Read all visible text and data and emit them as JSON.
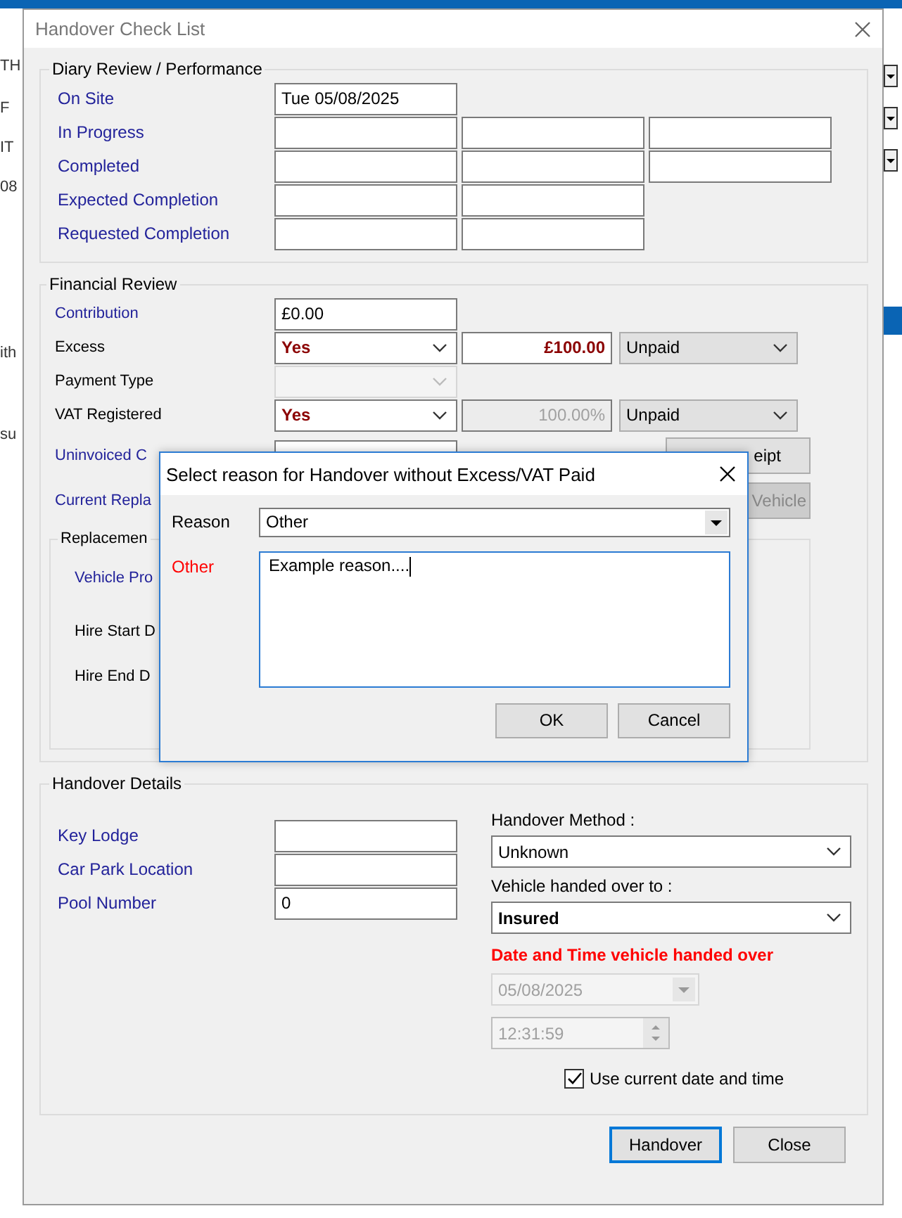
{
  "background": {
    "fragments": [
      "TH",
      "F",
      "IT",
      "08",
      "ith",
      "su"
    ]
  },
  "window": {
    "title": "Handover Check List"
  },
  "diary_review": {
    "title": "Diary Review / Performance",
    "rows": [
      {
        "label": "On Site",
        "fields": [
          {
            "kind": "text",
            "value": "Tue 05/08/2025"
          }
        ]
      },
      {
        "label": "In Progress",
        "fields": [
          {
            "kind": "text"
          },
          {
            "kind": "text"
          },
          {
            "kind": "text"
          }
        ]
      },
      {
        "label": "Completed",
        "fields": [
          {
            "kind": "text"
          },
          {
            "kind": "text"
          },
          {
            "kind": "text"
          }
        ]
      },
      {
        "label": "Expected Completion",
        "fields": [
          {
            "kind": "text"
          },
          {
            "kind": "text"
          }
        ]
      },
      {
        "label": "Requested Completion",
        "fields": [
          {
            "kind": "text"
          },
          {
            "kind": "text"
          }
        ]
      }
    ]
  },
  "financial_review": {
    "title": "Financial Review",
    "rows": [
      {
        "label": "Contribution",
        "highlighted": true,
        "controls": [
          {
            "kind": "text",
            "value": "£0.00"
          }
        ]
      },
      {
        "label": "Excess",
        "highlighted": false,
        "controls": [
          {
            "kind": "dropdown",
            "value": "Yes",
            "emphasis": true,
            "disabled": false
          },
          {
            "kind": "amount",
            "value": "£100.00",
            "disabled": false
          },
          {
            "kind": "status",
            "value": "Unpaid"
          }
        ]
      },
      {
        "label": "Payment Type",
        "highlighted": false,
        "controls": [
          {
            "kind": "dropdown",
            "disabled": true
          }
        ]
      },
      {
        "label": "VAT Registered",
        "highlighted": false,
        "controls": [
          {
            "kind": "dropdown",
            "value": "Yes",
            "emphasis": true,
            "disabled": false
          },
          {
            "kind": "amount",
            "value": "100.00%",
            "disabled": true
          },
          {
            "kind": "status",
            "value": "Unpaid"
          }
        ]
      },
      {
        "label": "Uninvoiced C",
        "highlighted": true,
        "controls": [
          {
            "kind": "text"
          },
          {
            "kind": "button",
            "value": "eipt",
            "disabled": false
          }
        ]
      },
      {
        "label": "Current Repla",
        "highlighted": true,
        "controls": [
          {
            "kind": "button",
            "value": "Vehicle",
            "disabled": true
          }
        ]
      }
    ],
    "replacement": {
      "title": "Replacemen",
      "rows": [
        {
          "label": "Vehicle Pro",
          "highlighted": true
        },
        {
          "label": "Hire Start D",
          "highlighted": false
        },
        {
          "label": "Hire End D",
          "highlighted": false
        }
      ]
    }
  },
  "reason_dialog": {
    "title": "Select reason for Handover without Excess/VAT Paid",
    "reason_label": "Reason",
    "reason_value": "Other",
    "other_label": "Other",
    "other_text": "Example reason....",
    "buttons": [
      "OK",
      "Cancel"
    ]
  },
  "handover_details": {
    "title": "Handover Details",
    "fields": [
      {
        "label": "Key Lodge"
      },
      {
        "label": "Car Park Location"
      },
      {
        "label": "Pool Number",
        "value": "0"
      }
    ],
    "method": {
      "label": "Handover Method :",
      "value": "Unknown"
    },
    "handed_to": {
      "label": "Vehicle handed over to :",
      "value": "Insured"
    },
    "datetime": {
      "label": "Date and Time vehicle handed over",
      "date": "05/08/2025",
      "time": "12:31:59",
      "disabled": true
    },
    "use_current": {
      "label": "Use current date and time",
      "checked": true
    }
  },
  "buttons": [
    {
      "label": "Handover",
      "default": true
    },
    {
      "label": "Close",
      "default": false
    }
  ]
}
